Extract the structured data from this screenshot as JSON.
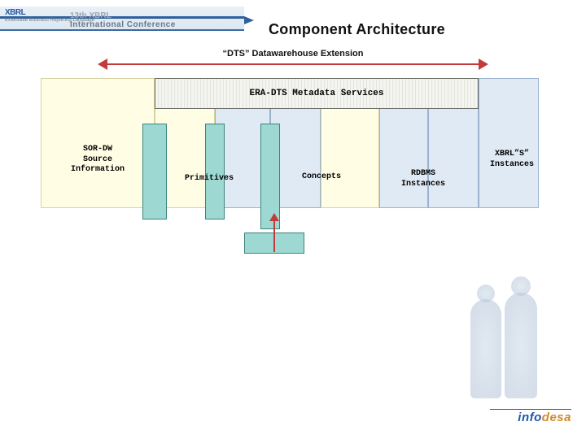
{
  "header": {
    "logo_main": "XBRL",
    "logo_sub": "eXtensible Business Reporting Language",
    "conference_line_prefix": "13th XBRL",
    "conference_line": "International Conference"
  },
  "title": "Component Architecture",
  "subtitle": "“DTS” Datawarehouse Extension",
  "meta_bar": "ERA-DTS Metadata Services",
  "labels": {
    "sor": "SOR-DW\nSource\nInformation",
    "primitives": "Primitives",
    "concepts": "Concepts",
    "rdbms": "RDBMS\nInstances",
    "xbrl": "XBRL”S”\nInstances"
  },
  "footer_brand": "infodesa",
  "colors": {
    "accent_blue": "#2156a5",
    "accent_red": "#c33a3a",
    "teal": "#9ed8d3",
    "yellow_col": "#fffde4",
    "blue_col": "#e0eaf5"
  }
}
